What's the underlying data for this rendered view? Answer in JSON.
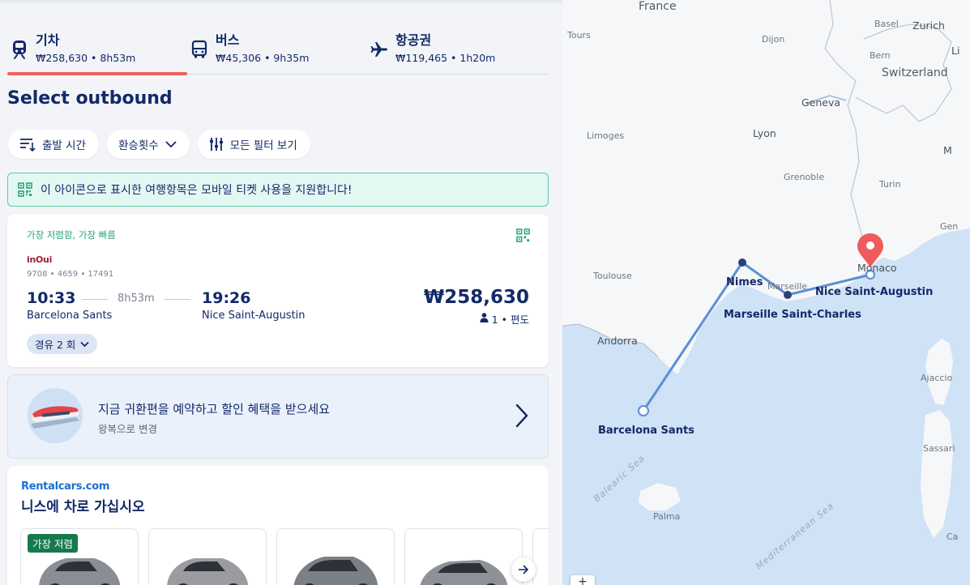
{
  "tabs": [
    {
      "name": "기차",
      "meta": "₩258,630 • 8h53m",
      "icon": "train-icon",
      "active": true
    },
    {
      "name": "버스",
      "meta": "₩45,306 • 9h35m",
      "icon": "bus-icon",
      "active": false
    },
    {
      "name": "항공권",
      "meta": "₩119,465 • 1h20m",
      "icon": "plane-icon",
      "active": false
    }
  ],
  "heading": "Select outbound",
  "filters": {
    "departure_time": "출발 시간",
    "transfers": "환승횟수",
    "all_filters": "모든 필터 보기"
  },
  "notice": "이 아이콘으로 표시한 여행항목은 모바일 티켓 사용을 지원합니다!",
  "result": {
    "tagline": "가장 저렴함, 가장 빠름",
    "carrier": "inOui",
    "train_numbers": "9708 • 4659 • 17491",
    "departure_time": "10:33",
    "duration": "8h53m",
    "arrival_time": "19:26",
    "from": "Barcelona Sants",
    "to": "Nice Saint-Augustin",
    "price": "₩258,630",
    "passengers": "1 • 편도",
    "stops": "경유 2 회"
  },
  "promo": {
    "title": "지금 귀환편을 예약하고 할인 혜택을 받으세요",
    "subtitle": "왕복으로 변경"
  },
  "rental": {
    "logo": "Rentalcars.com",
    "title": "니스에 차로 가십시오",
    "badge": "가장 저렴"
  },
  "map": {
    "countries": {
      "france": "France",
      "switzerland": "Switzerland",
      "andorra": "Andorra",
      "monaco": "Monaco"
    },
    "cities": {
      "tours": "Tours",
      "dijon": "Dijon",
      "basel": "Basel",
      "zurich": "Zurich",
      "bern": "Bern",
      "geneva": "Geneva",
      "limoges": "Limoges",
      "lyon": "Lyon",
      "grenoble": "Grenoble",
      "turin": "Turin",
      "toulouse": "Toulouse",
      "marseille": "Marseille",
      "palma": "Palma",
      "sassari": "Sassari",
      "ajaccio": "Ajaccio",
      "genoa": "Gen",
      "li": "Li",
      "m": "M",
      "ca": "Ca"
    },
    "seas": {
      "balearic": "Balearic Sea",
      "mediterranean": "Mediterranean Sea"
    },
    "stations": {
      "barcelona": "Barcelona Sants",
      "nimes": "Nimes",
      "marseille": "Marseille Saint-Charles",
      "nice": "Nice Saint-Augustin"
    },
    "zoom_in": "+"
  },
  "colors": {
    "primary": "#132968",
    "accent_tab": "#f0605a",
    "mobile_ticket_green": "#2aa378",
    "route_line": "#5b8fd6",
    "sea": "#cfe2f6",
    "pin": "#ef5b5b"
  }
}
